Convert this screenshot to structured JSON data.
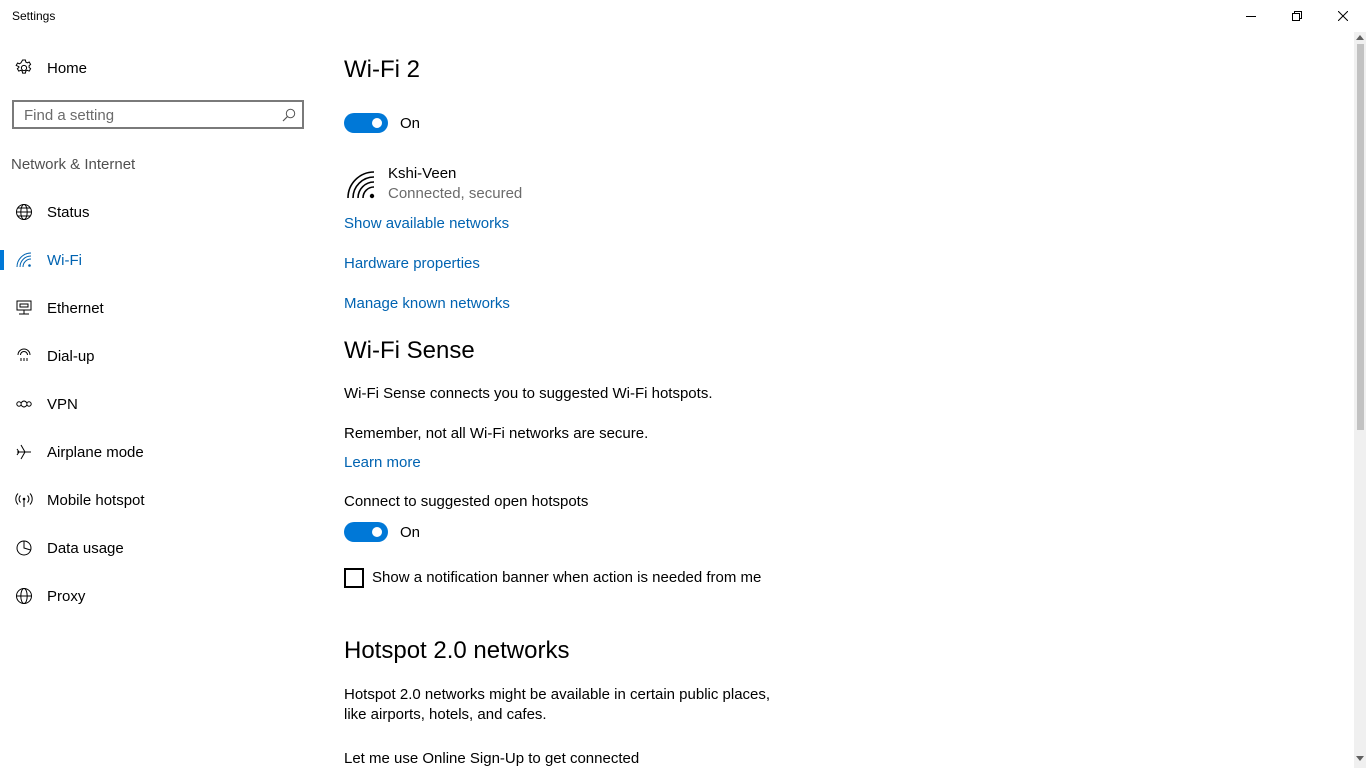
{
  "window": {
    "title": "Settings",
    "controls": {
      "minimize": "minimize-icon",
      "restore": "restore-icon",
      "close": "close-icon"
    }
  },
  "sidebar": {
    "home_label": "Home",
    "search_placeholder": "Find a setting",
    "section_label": "Network & Internet",
    "items": [
      {
        "label": "Status",
        "icon": "globe-status-icon"
      },
      {
        "label": "Wi-Fi",
        "icon": "wifi-icon",
        "active": true
      },
      {
        "label": "Ethernet",
        "icon": "ethernet-icon"
      },
      {
        "label": "Dial-up",
        "icon": "dialup-icon"
      },
      {
        "label": "VPN",
        "icon": "vpn-icon"
      },
      {
        "label": "Airplane mode",
        "icon": "airplane-icon"
      },
      {
        "label": "Mobile hotspot",
        "icon": "hotspot-icon"
      },
      {
        "label": "Data usage",
        "icon": "data-usage-icon"
      },
      {
        "label": "Proxy",
        "icon": "globe-icon"
      }
    ]
  },
  "main": {
    "wifi_title": "Wi-Fi 2",
    "wifi_toggle_label": "On",
    "network": {
      "name": "Kshi-Veen",
      "status": "Connected, secured"
    },
    "links": {
      "show_available": "Show available networks",
      "hardware_properties": "Hardware properties",
      "manage_known": "Manage known networks"
    },
    "wifi_sense": {
      "title": "Wi-Fi Sense",
      "description": "Wi-Fi Sense connects you to suggested Wi-Fi hotspots.",
      "remember": "Remember, not all Wi-Fi networks are secure.",
      "learn_more": "Learn more",
      "connect_label": "Connect to suggested open hotspots",
      "connect_toggle_label": "On",
      "notification_checkbox_label": "Show a notification banner when action is needed from me"
    },
    "hotspot20": {
      "title": "Hotspot 2.0 networks",
      "description_line1": "Hotspot 2.0 networks might be available in certain public places,",
      "description_line2": "like airports, hotels, and cafes.",
      "signup_label": "Let me use Online Sign-Up to get connected"
    }
  },
  "colors": {
    "accent": "#0078d7",
    "link": "#0063b1",
    "secondary_text": "#6b6b6b"
  }
}
